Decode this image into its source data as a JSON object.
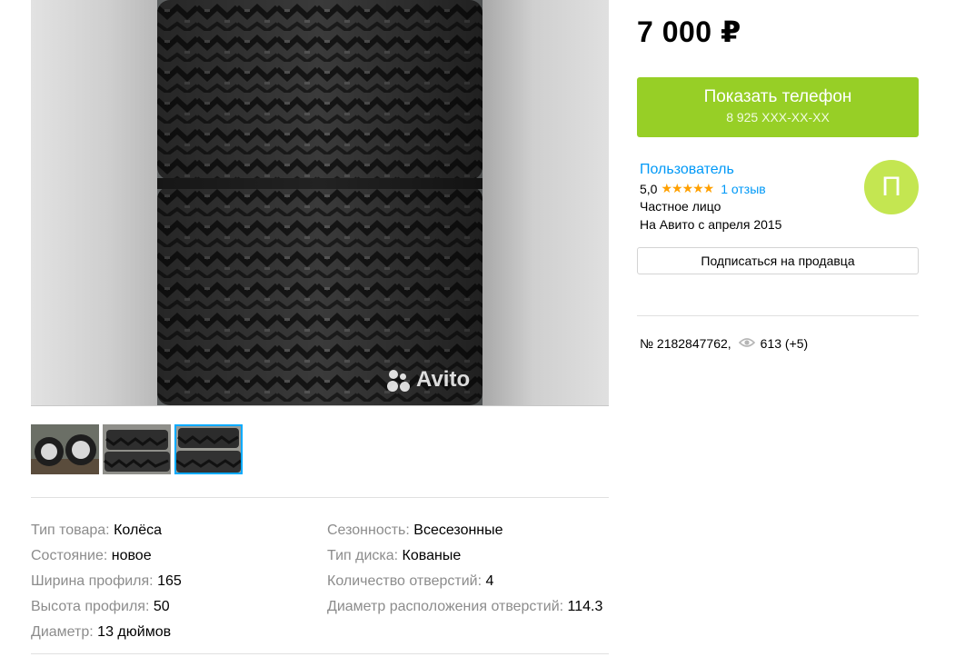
{
  "price": "7 000 ₽",
  "phone_button": {
    "label": "Показать телефон",
    "number": "8 925 XXX-XX-XX"
  },
  "seller": {
    "name": "Пользователь",
    "rating": "5,0",
    "stars": "★★★★★",
    "reviews": "1 отзыв",
    "type": "Частное лицо",
    "since": "На Авито с апреля 2015",
    "avatar_letter": "П",
    "subscribe_label": "Подписаться на продавца"
  },
  "item_meta": {
    "number": "№ 2182847762,",
    "views": "613 (+5)"
  },
  "gallery": {
    "watermark": "Avito",
    "thumbnails": 3,
    "active_thumbnail": 3
  },
  "params_left": [
    {
      "label": "Тип товара:",
      "value": "Колёса"
    },
    {
      "label": "Состояние:",
      "value": "новое"
    },
    {
      "label": "Ширина профиля:",
      "value": "165"
    },
    {
      "label": "Высота профиля:",
      "value": "50"
    },
    {
      "label": "Диаметр:",
      "value": "13 дюймов"
    }
  ],
  "params_right": [
    {
      "label": "Сезонность:",
      "value": "Всесезонные"
    },
    {
      "label": "Тип диска:",
      "value": "Кованые"
    },
    {
      "label": "Количество отверстий:",
      "value": "4"
    },
    {
      "label": "Диаметр расположения отверстий:",
      "value": "114.3"
    }
  ],
  "colors": {
    "accent_green": "#97cf26",
    "link_blue": "#0099f7",
    "star_orange": "#ffa000",
    "avatar_green": "#c4e651",
    "label_gray": "#8c8c8c"
  }
}
